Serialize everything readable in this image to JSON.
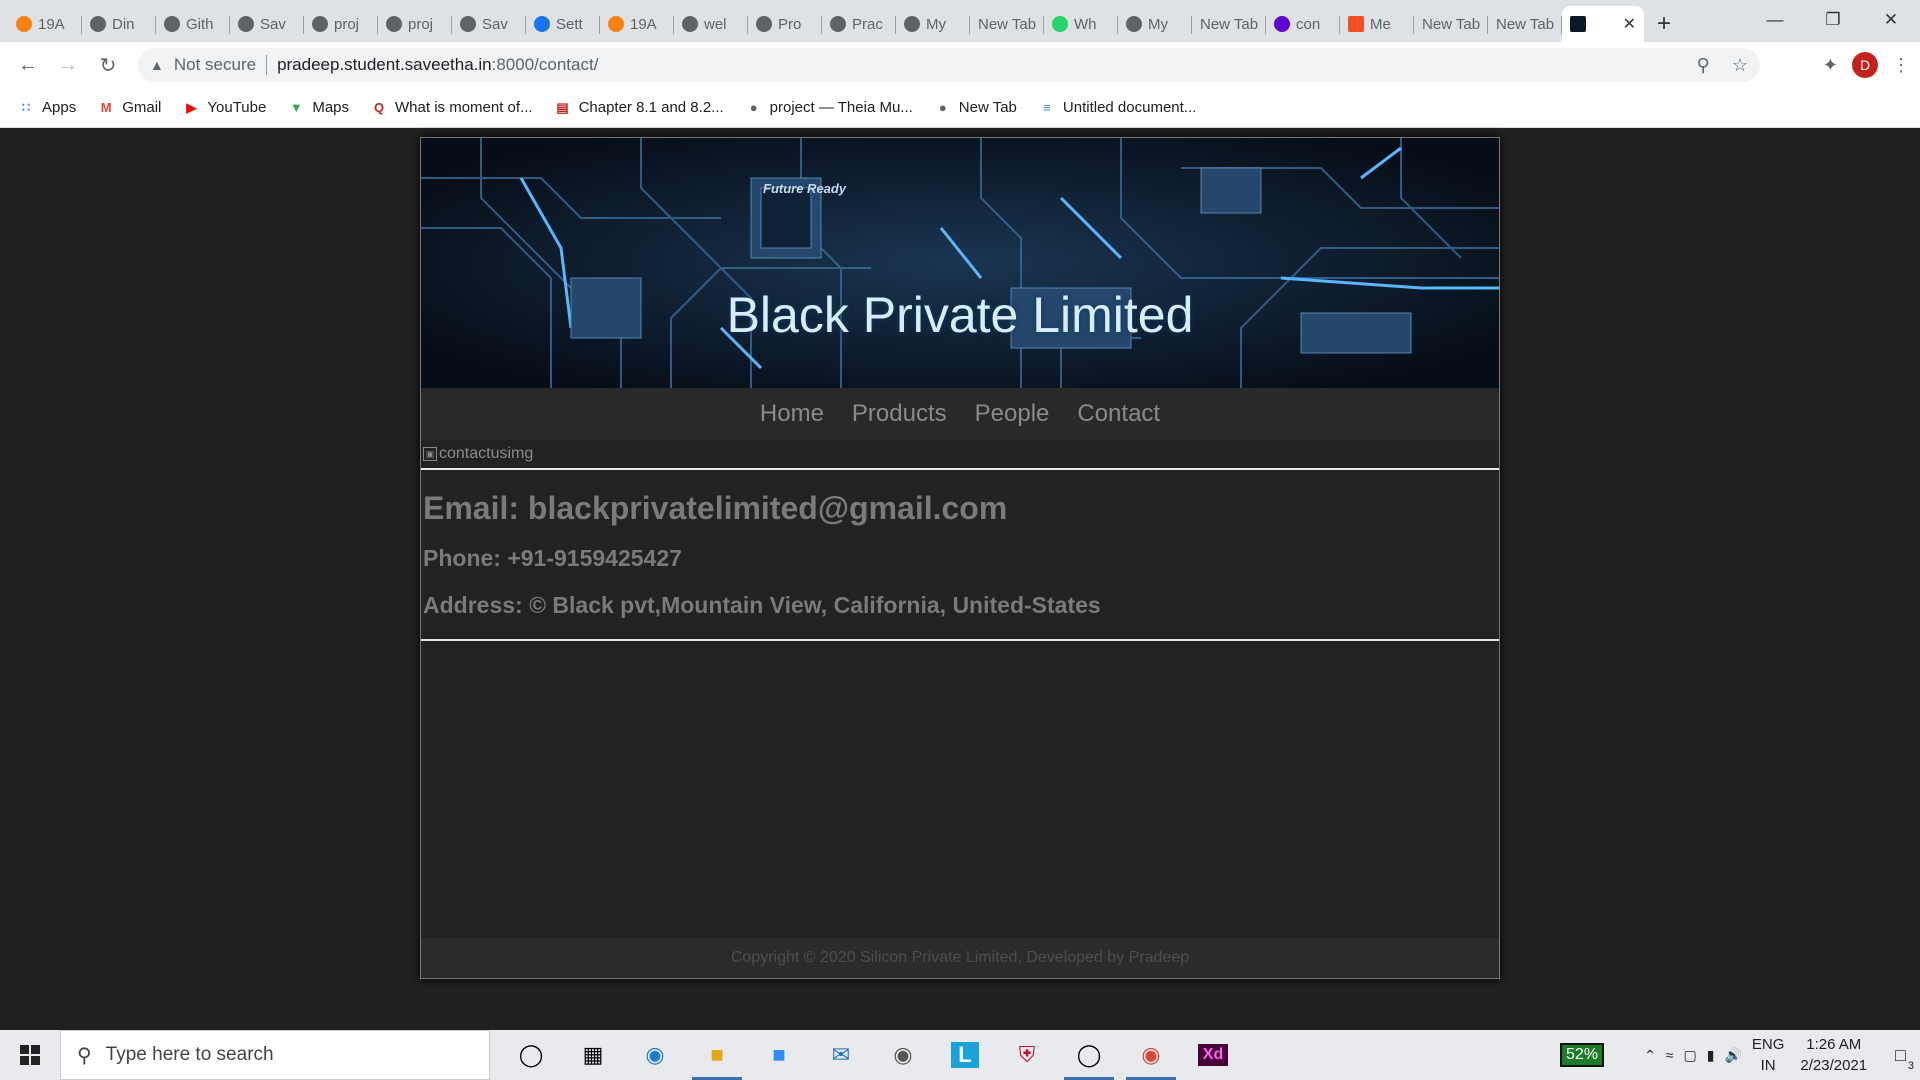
{
  "browser": {
    "tabs": [
      {
        "label": "19A",
        "icon": "moodle-icon"
      },
      {
        "label": "Din",
        "icon": "globe-icon"
      },
      {
        "label": "Gith",
        "icon": "github-icon"
      },
      {
        "label": "Sav",
        "icon": "globe-icon"
      },
      {
        "label": "proj",
        "icon": "globe-icon"
      },
      {
        "label": "proj",
        "icon": "globe-icon"
      },
      {
        "label": "Sav",
        "icon": "globe-icon"
      },
      {
        "label": "Sett",
        "icon": "gear-icon"
      },
      {
        "label": "19A",
        "icon": "moodle-icon"
      },
      {
        "label": "wel",
        "icon": "globe-icon"
      },
      {
        "label": "Pro",
        "icon": "github-icon"
      },
      {
        "label": "Prac",
        "icon": "github-icon"
      },
      {
        "label": "My",
        "icon": "globe-icon"
      },
      {
        "label": "New Tab",
        "icon": "none"
      },
      {
        "label": "Wh",
        "icon": "whatsapp-icon"
      },
      {
        "label": "My",
        "icon": "globe-icon"
      },
      {
        "label": "New Tab",
        "icon": "none"
      },
      {
        "label": "con",
        "icon": "yahoo-icon"
      },
      {
        "label": "Me",
        "icon": "microsoft-icon"
      },
      {
        "label": "New Tab",
        "icon": "none"
      },
      {
        "label": "New Tab",
        "icon": "none"
      }
    ],
    "active_tab_close": "✕",
    "new_tab": "+",
    "security_label": "Not secure",
    "url_host": "pradeep.student.saveetha.in",
    "url_path": ":8000/contact/",
    "profile_initial": "D",
    "bookmarks": [
      {
        "label": "Apps",
        "icon": "apps-grid-icon"
      },
      {
        "label": "Gmail",
        "icon": "gmail-icon"
      },
      {
        "label": "YouTube",
        "icon": "youtube-icon"
      },
      {
        "label": "Maps",
        "icon": "maps-pin-icon"
      },
      {
        "label": "What is moment of...",
        "icon": "quora-icon"
      },
      {
        "label": "Chapter 8.1 and 8.2...",
        "icon": "slides-icon"
      },
      {
        "label": "project — Theia Mu...",
        "icon": "globe-icon"
      },
      {
        "label": "New Tab",
        "icon": "globe-icon"
      },
      {
        "label": "Untitled document...",
        "icon": "docs-icon"
      }
    ]
  },
  "site": {
    "title": "Black Private Limited",
    "hero_tag": "Future Ready",
    "nav": [
      "Home",
      "Products",
      "People",
      "Contact"
    ],
    "broken_image_alt": "contactusimg",
    "email": "Email: blackprivatelimited@gmail.com",
    "phone": "Phone: +91-9159425427",
    "address": "Address: © Black pvt,Mountain View, California, United-States",
    "footer": "Copyright © 2020 Silicon Private Limited, Developed by Pradeep"
  },
  "taskbar": {
    "search_placeholder": "Type here to search",
    "battery": "52%",
    "lang_top": "ENG",
    "lang_bottom": "IN",
    "time": "1:26 AM",
    "date": "2/23/2021",
    "notifications": "3"
  }
}
